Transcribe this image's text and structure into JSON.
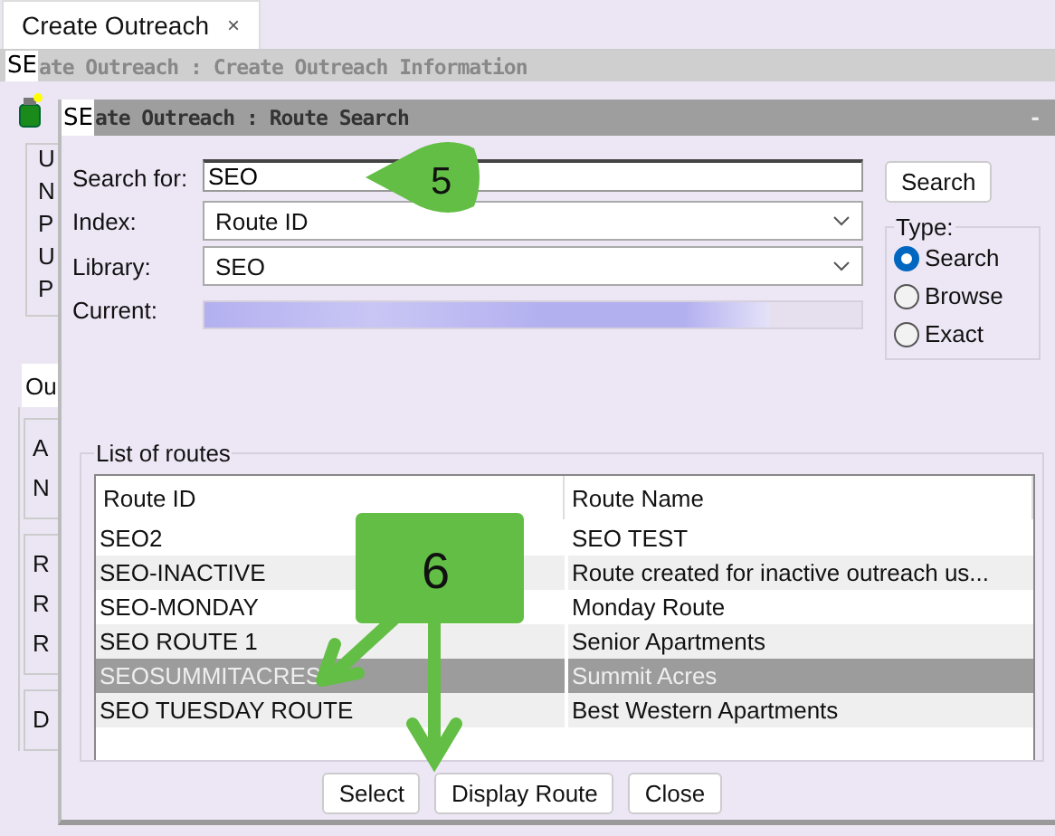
{
  "tab": {
    "label": "Create Outreach",
    "close": "×"
  },
  "background_window": {
    "badge": "SE",
    "title": "ate Outreach : Create Outreach Information",
    "group_letters": [
      "U",
      "N",
      "P",
      "U",
      "P"
    ],
    "tab": "Ou",
    "lower_letters": [
      [
        "A",
        "N"
      ],
      [
        "R",
        "R",
        "R"
      ],
      [
        "D"
      ]
    ]
  },
  "dialog": {
    "badge": "SE",
    "title": "ate Outreach : Route Search",
    "minimize": "-",
    "search_label": "Search for:",
    "search_value": "SEO",
    "search_button": "Search",
    "index_label": "Index:",
    "index_value": "Route ID",
    "library_label": "Library:",
    "library_value": "SEO",
    "current": {
      "label": "Current:",
      "level": 0.86
    },
    "type_label": "Type:",
    "types": [
      {
        "label": "Search",
        "selected": true
      },
      {
        "label": "Browse",
        "selected": false
      },
      {
        "label": "Exact",
        "selected": false
      }
    ],
    "list_label": "List of routes",
    "columns": [
      "Route ID",
      "Route Name"
    ],
    "rows": [
      {
        "id": "SEO2",
        "name": "SEO TEST",
        "selected": false
      },
      {
        "id": "SEO-INACTIVE",
        "name": "Route created for inactive outreach us...",
        "selected": false
      },
      {
        "id": "SEO-MONDAY",
        "name": "Monday Route",
        "selected": false
      },
      {
        "id": "SEO ROUTE 1",
        "name": "Senior Apartments",
        "selected": false
      },
      {
        "id": "SEOSUMMITACRES",
        "name": "Summit Acres",
        "selected": true
      },
      {
        "id": "SEO TUESDAY ROUTE",
        "name": "Best Western Apartments",
        "selected": false
      }
    ],
    "buttons": [
      "Select",
      "Display Route",
      "Close"
    ]
  },
  "callouts": [
    {
      "number": "5"
    },
    {
      "number": "6"
    }
  ]
}
